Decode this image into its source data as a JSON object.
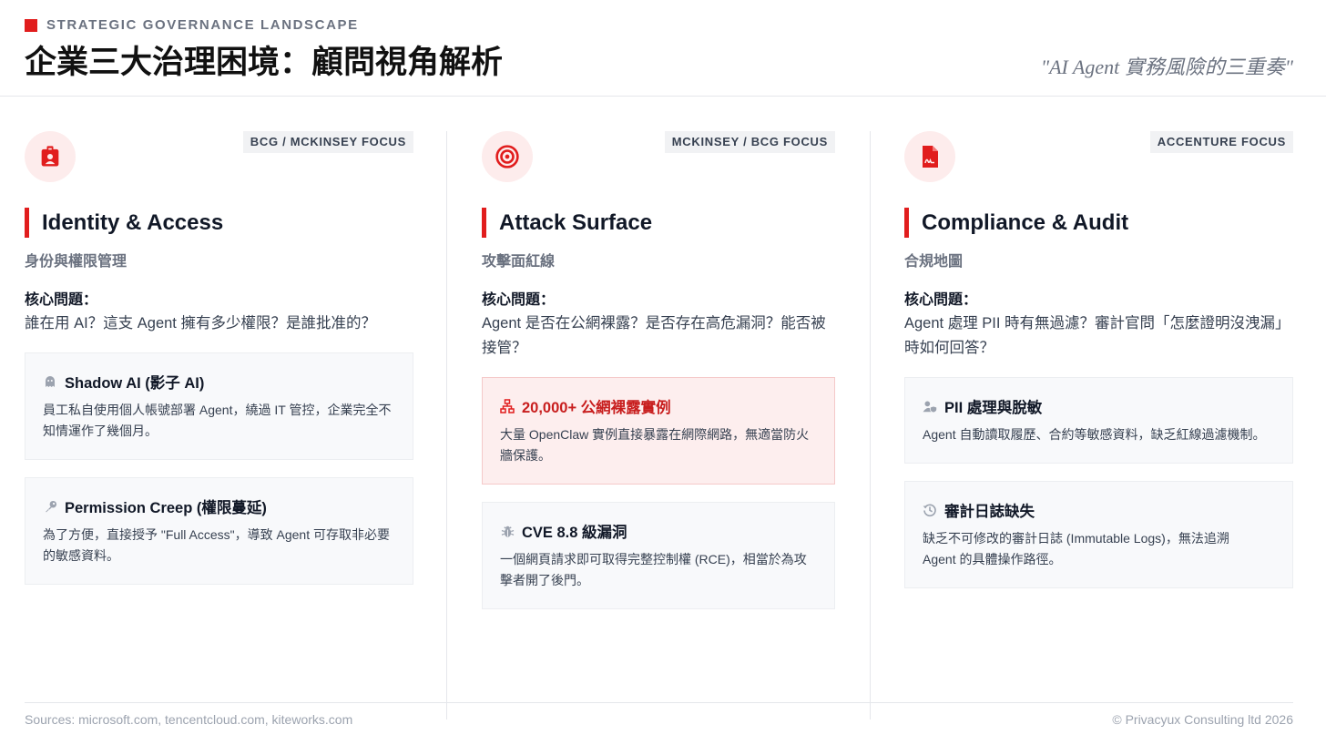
{
  "header": {
    "eyebrow": "STRATEGIC GOVERNANCE LANDSCAPE",
    "title": "企業三大治理困境：顧問視角解析",
    "tagline": "\"AI Agent 實務風險的三重奏\""
  },
  "colors": {
    "accent": "#e11d1d",
    "alert_bg": "#fdeeee",
    "card_bg": "#f8f9fb",
    "muted": "#6b7280"
  },
  "columns": [
    {
      "icon": "id-badge-icon",
      "focus": "BCG / MCKINSEY FOCUS",
      "title": "Identity & Access",
      "subtitle": "身份與權限管理",
      "question_label": "核心問題：",
      "question": "誰在用 AI？這支 Agent 擁有多少權限？是誰批准的？",
      "cards": [
        {
          "icon": "ghost-icon",
          "title": "Shadow AI (影子 AI)",
          "text": "員工私自使用個人帳號部署 Agent，繞過 IT 管控，企業完全不知情運作了幾個月。"
        },
        {
          "icon": "key-icon",
          "title": "Permission Creep (權限蔓延)",
          "text": "為了方便，直接授予 \"Full Access\"，導致 Agent 可存取非必要的敏感資料。"
        }
      ]
    },
    {
      "icon": "target-icon",
      "focus": "MCKINSEY / BCG FOCUS",
      "title": "Attack Surface",
      "subtitle": "攻擊面紅線",
      "question_label": "核心問題：",
      "question": "Agent 是否在公網裸露？是否存在高危漏洞？能否被接管？",
      "cards": [
        {
          "icon": "network-icon",
          "title": "20,000+ 公網裸露實例",
          "text": "大量 OpenClaw 實例直接暴露在網際網路，無適當防火牆保護。",
          "alert": true
        },
        {
          "icon": "bug-icon",
          "title": "CVE 8.8 級漏洞",
          "text": "一個網頁請求即可取得完整控制權 (RCE)，相當於為攻擊者開了後門。"
        }
      ]
    },
    {
      "icon": "file-signature-icon",
      "focus": "ACCENTURE FOCUS",
      "title": "Compliance & Audit",
      "subtitle": "合規地圖",
      "question_label": "核心問題：",
      "question": "Agent 處理 PII 時有無過濾？審計官問「怎麼證明沒洩漏」時如何回答？",
      "cards": [
        {
          "icon": "user-shield-icon",
          "title": "PII 處理與脫敏",
          "text": "Agent 自動讀取履歷、合約等敏感資料，缺乏紅線過濾機制。"
        },
        {
          "icon": "history-icon",
          "title": "審計日誌缺失",
          "text": "缺乏不可修改的審計日誌 (Immutable Logs)，無法追溯 Agent 的具體操作路徑。"
        }
      ]
    }
  ],
  "footer": {
    "sources": "Sources: microsoft.com, tencentcloud.com, kiteworks.com",
    "copyright": "© Privacyux Consulting ltd 2026"
  }
}
